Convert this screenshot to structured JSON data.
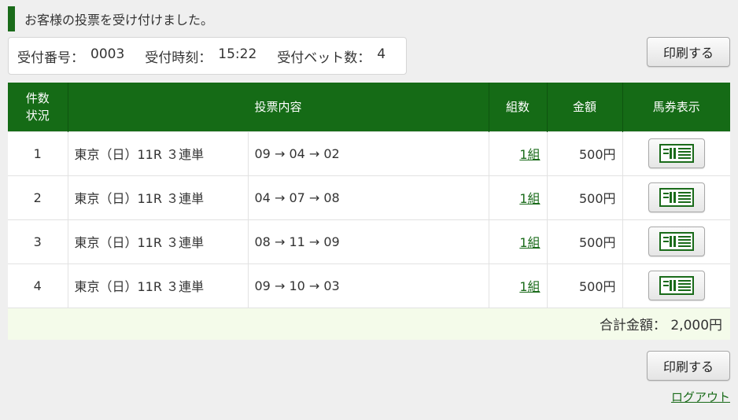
{
  "notice": "お客様の投票を受け付けました。",
  "receipt": {
    "number_label": "受付番号：",
    "number": "0003",
    "time_label": "受付時刻：",
    "time": "15:22",
    "bets_label": "受付ベット数：",
    "bets": "4"
  },
  "print_label": "印刷する",
  "table": {
    "headers": {
      "no": [
        "件数",
        "状況"
      ],
      "content": "投票内容",
      "kumi": "組数",
      "amount": "金額",
      "ticket": "馬券表示"
    },
    "rows": [
      {
        "no": "1",
        "race": "東京（日）11R ３連単",
        "combo": "09 → 04 → 02",
        "kumi": "1組",
        "amount": "500円"
      },
      {
        "no": "2",
        "race": "東京（日）11R ３連単",
        "combo": "04 → 07 → 08",
        "kumi": "1組",
        "amount": "500円"
      },
      {
        "no": "3",
        "race": "東京（日）11R ３連単",
        "combo": "08 → 11 → 09",
        "kumi": "1組",
        "amount": "500円"
      },
      {
        "no": "4",
        "race": "東京（日）11R ３連単",
        "combo": "09 → 10 → 03",
        "kumi": "1組",
        "amount": "500円"
      }
    ],
    "total_label": "合計金額：",
    "total": "2,000円"
  },
  "logout": "ログアウト",
  "icons": {
    "ticket": "ticket-icon"
  },
  "colors": {
    "accent": "#156b16",
    "total_bg": "#f4fbea"
  }
}
